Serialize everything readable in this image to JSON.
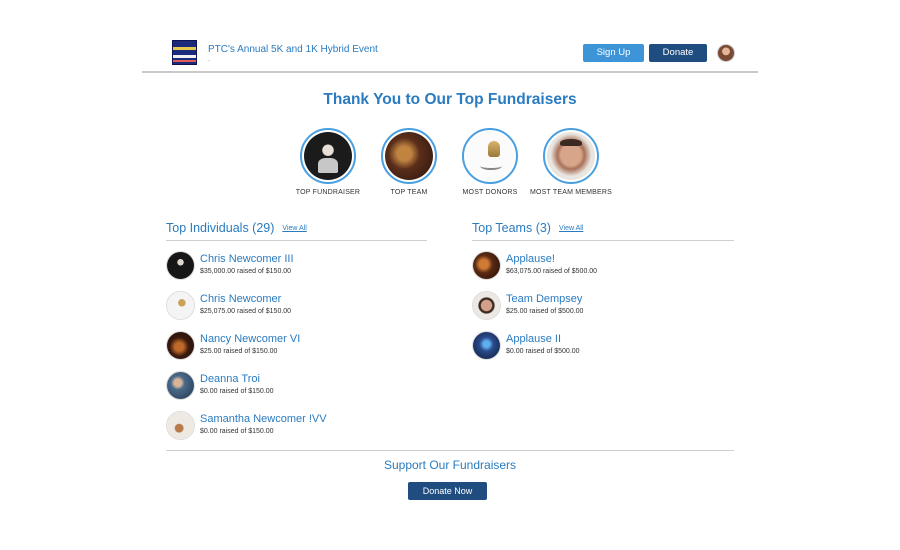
{
  "header": {
    "event_title": "PTC's Annual 5K and 1K Hybrid Event",
    "event_subtitle": ".",
    "signup_label": "Sign Up",
    "donate_label": "Donate"
  },
  "main_title": "Thank You to Our Top Fundraisers",
  "awards": [
    {
      "label": "TOP FUNDRAISER",
      "icon": "phantom-mask-photo"
    },
    {
      "label": "TOP TEAM",
      "icon": "guitarist-photo"
    },
    {
      "label": "MOST DONORS",
      "icon": "microphone-photo"
    },
    {
      "label": "MOST TEAM MEMBERS",
      "icon": "man-portrait-photo"
    }
  ],
  "individuals": {
    "title": "Top Individuals (29)",
    "view_all": "View All",
    "rows": [
      {
        "name": "Chris Newcomer III",
        "raised": "$35,000.00 raised of $150.00"
      },
      {
        "name": "Chris Newcomer",
        "raised": "$25,075.00 raised of $150.00"
      },
      {
        "name": "Nancy Newcomer VI",
        "raised": "$25.00 raised of $150.00"
      },
      {
        "name": "Deanna Troi",
        "raised": "$0.00 raised of $150.00"
      },
      {
        "name": "Samantha Newcomer !VV",
        "raised": "$0.00 raised of $150.00"
      }
    ]
  },
  "teams": {
    "title": "Top Teams (3)",
    "view_all": "View All",
    "rows": [
      {
        "name": "Applause!",
        "raised": "$63,075.00 raised of $500.00"
      },
      {
        "name": "Team Dempsey",
        "raised": "$25.00 raised of $500.00"
      },
      {
        "name": "Applause II",
        "raised": "$0.00 raised of $500.00"
      }
    ]
  },
  "support": {
    "title": "Support Our Fundraisers",
    "button_label": "Donate Now"
  },
  "colors": {
    "accent": "#2a7bbf",
    "signup_button": "#3d95d8",
    "donate_button": "#1f4d80"
  }
}
